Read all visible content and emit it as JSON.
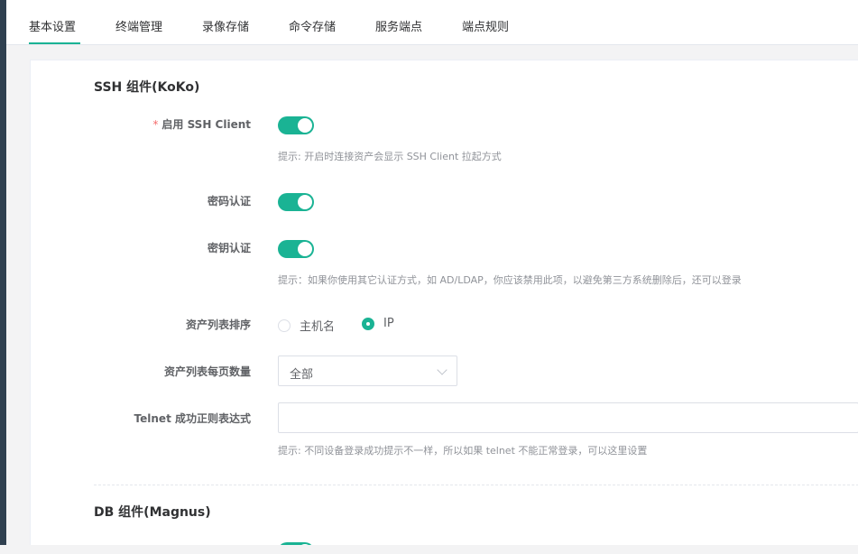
{
  "tabs": [
    "基本设置",
    "终端管理",
    "录像存储",
    "命令存储",
    "服务端点",
    "端点规则"
  ],
  "active_tab": "基本设置",
  "ssh_section": {
    "title": "SSH 组件(KoKo)",
    "enable_ssh_client": {
      "required_mark": "*",
      "label": "启用 SSH Client",
      "enabled": true,
      "hint": "提示: 开启时连接资产会显示 SSH Client 拉起方式"
    },
    "password_auth": {
      "label": "密码认证",
      "enabled": true
    },
    "key_auth": {
      "label": "密钥认证",
      "enabled": true,
      "hint": "提示：如果你使用其它认证方式，如 AD/LDAP，你应该禁用此项，以避免第三方系统删除后，还可以登录"
    },
    "asset_list_sort": {
      "label": "资产列表排序",
      "options": [
        "主机名",
        "IP"
      ],
      "selected": "IP"
    },
    "asset_list_page_size": {
      "label": "资产列表每页数量",
      "value": "全部"
    },
    "telnet_regex": {
      "label": "Telnet 成功正则表达式",
      "value": "",
      "hint": "提示: 不同设备登录成功提示不一样，所以如果 telnet 不能正常登录，可以这里设置"
    }
  },
  "db_section": {
    "title": "DB 组件(Magnus)"
  },
  "colors": {
    "accent": "#1ab394",
    "required": "#f56c6c"
  }
}
